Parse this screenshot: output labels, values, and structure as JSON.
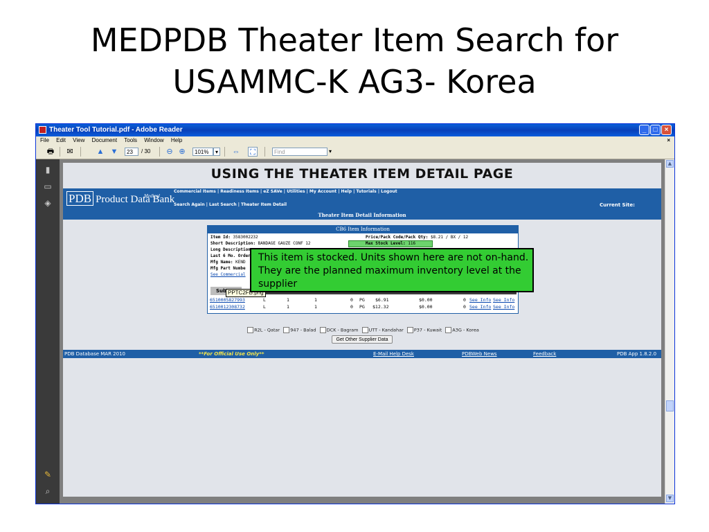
{
  "slide": {
    "title_line1": "MEDPDB Theater Item Search for",
    "title_line2": "USAMMC-K AG3- Korea"
  },
  "window": {
    "title": "Theater Tool Tutorial.pdf - Adobe Reader",
    "minimize_icon": "minimize-icon",
    "maximize_icon": "maximize-icon",
    "close_icon": "close-icon"
  },
  "menu": {
    "items": [
      "File",
      "Edit",
      "View",
      "Document",
      "Tools",
      "Window",
      "Help"
    ],
    "close_glyph": "×"
  },
  "toolbar": {
    "page_current": "23",
    "page_sep": "/ 30",
    "zoom": "101%",
    "find_placeholder": "Find"
  },
  "document": {
    "banner_title": "USING THE THEATER ITEM DETAIL PAGE",
    "logo_pdb": "PDB",
    "logo_text": "Product Data Bank",
    "logo_medical": "Medical",
    "commercial_nav": "Commercial Items | Readiness Items | eZ SAVe | Utilities | My Account | Help | Tutorials | Logout",
    "search_nav": "Search Again | Last Search | Theater Item Detail",
    "current_site": "Current Site:",
    "detail_header": "Theater Item Detail Information",
    "info_box": {
      "header": "CB6 Item Information",
      "item_id_label": "Item Id:",
      "item_id_value": "3583002232",
      "price_label": "Price/Pack Code/Pack Qty:",
      "price_value": "$8.21 / BX / 12",
      "short_desc_label": "Short Description:",
      "short_desc_value": "BANDAGE GAUZE CONF 12",
      "max_stock_label": "Max Stock Level:",
      "max_stock_value": "116",
      "long_desc_label": "Long Description",
      "last6_label": "Last 6 Mo. Order",
      "mfg_name_label": "Mfg Name:",
      "mfg_name_value": "KEND",
      "mfg_part_label": "Mfg Part Numbe",
      "see_commercial": "See Commercial",
      "sub_tab": "Sub",
      "rows": [
        {
          "nsn": "6510005827993",
          "c1": "L",
          "c2": "1",
          "c3": "1",
          "c4": "0",
          "um": "PG",
          "price": "$6.91",
          "value": "$0.00",
          "orders": "0",
          "info1": "See Info",
          "info2": "See Info"
        },
        {
          "nsn": "6510012308732",
          "c1": "L",
          "c2": "1",
          "c3": "1",
          "c4": "0",
          "um": "PG",
          "price": "$12.32",
          "value": "$0.00",
          "orders": "0",
          "info1": "See Info",
          "info2": "See Info"
        }
      ]
    },
    "tooltip": "PPTC2FB.png",
    "callout": "This item is stocked.  Units shown here are not on-hand.  They are the planned maximum inventory level at the supplier",
    "sites": [
      "R2L - Qatar",
      "947 - Balad",
      "DCK - Bagram",
      "UTT - Kandahar",
      "P37 - Kuwait",
      "A3G - Korea"
    ],
    "get_button": "Get Other Supplier Data",
    "footer": {
      "db": "PDB Database MAR 2010",
      "official": "**For Official Use Only**",
      "email": "E-Mail Help Desk",
      "news": "PDBWeb News",
      "feedback": "Feedback",
      "version": "PDB App 1.8.2.0"
    }
  }
}
